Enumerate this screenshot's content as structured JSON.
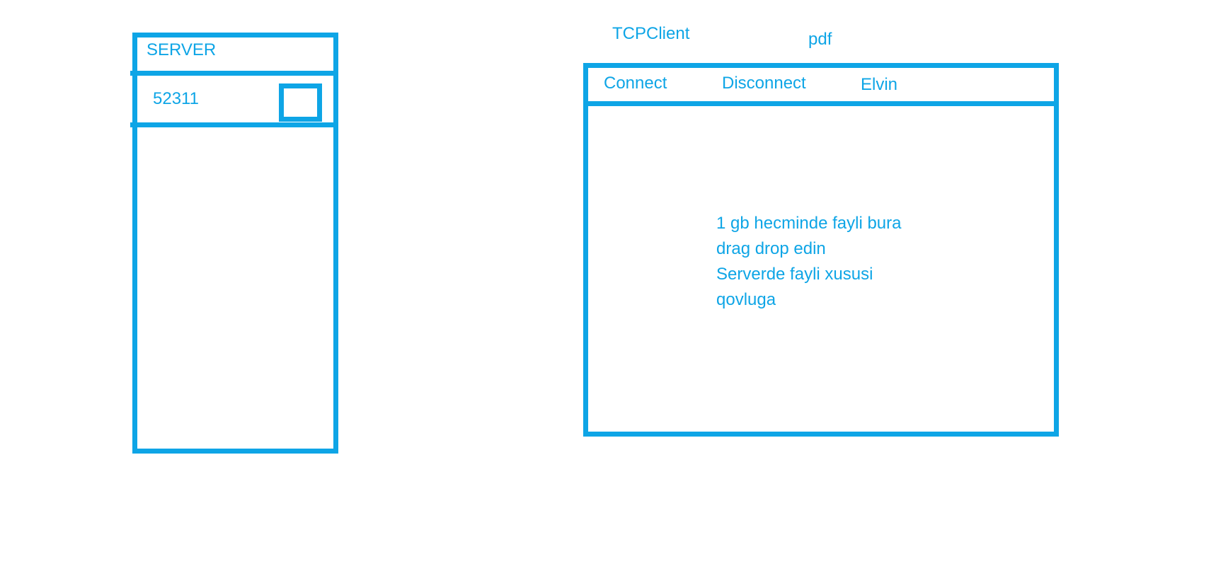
{
  "server": {
    "title": "SERVER",
    "port_value": "52311"
  },
  "client": {
    "title": "TCPClient",
    "file_type_label": "pdf",
    "toolbar": {
      "connect_label": "Connect",
      "disconnect_label": "Disconnect",
      "user_label": "Elvin"
    },
    "dropzone": {
      "lines": [
        "1 gb hecminde fayli bura",
        "drag drop edin",
        "Serverde fayli xususi",
        "qovluga"
      ]
    }
  },
  "colors": {
    "accent": "#0ea5e6",
    "background": "#ffffff"
  }
}
